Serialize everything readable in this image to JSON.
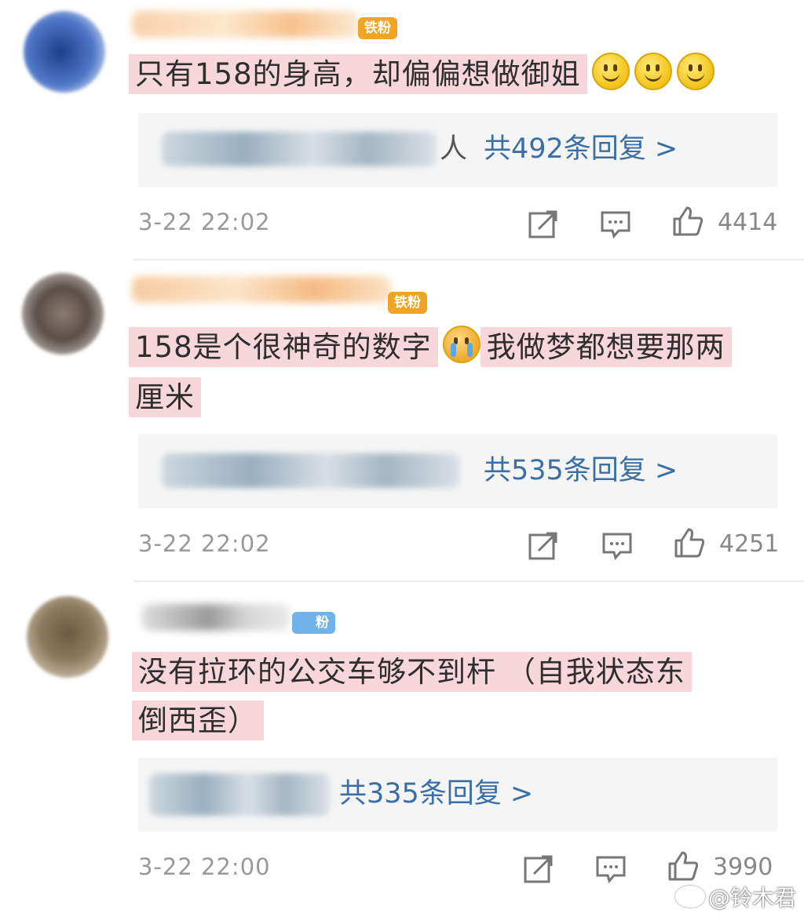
{
  "comments": [
    {
      "badge": "铁粉",
      "badge_color": "#f0a424",
      "text": "只有158的身高，却偏偏想做御姐",
      "reply_count_label": "共492条回复 >",
      "reply_prefix": "人",
      "time": "3-22 22:02",
      "likes": "4414"
    },
    {
      "badge": "铁粉",
      "badge_color": "#f0a424",
      "text_line1": "158是个很神奇的数字",
      "text_line1b": "我做梦都想要那两",
      "text_line2": "厘米",
      "reply_count_label": "共535条回复 >",
      "time": "3-22 22:02",
      "likes": "4251"
    },
    {
      "badge": "粉",
      "badge_color": "#6fb3e8",
      "text_line1": "没有拉环的公交车够不到杆 （自我状态东",
      "text_line2": "倒西歪）",
      "reply_count_label": "共335条回复 >",
      "time": "3-22 22:00",
      "likes": "3990"
    }
  ],
  "icons": [
    "share-icon",
    "comment-icon",
    "like-icon",
    "smile-emoji",
    "crying-emoji",
    "weibo-logo"
  ],
  "watermark": "@铃木君",
  "colors": {
    "highlight": "#f8d7dc",
    "reply_link": "#3a6fa6",
    "meta": "#999999"
  }
}
